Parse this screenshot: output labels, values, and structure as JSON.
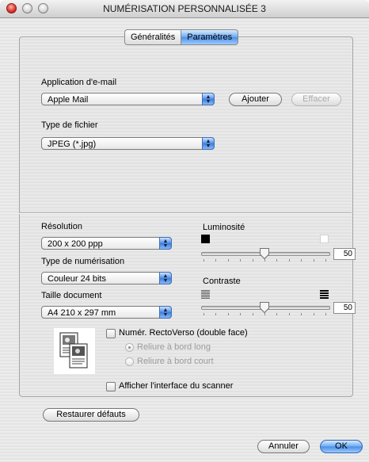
{
  "window": {
    "title": "NUMÉRISATION PERSONNALISÉE 3"
  },
  "tabs": [
    {
      "label": "Généralités",
      "active": false
    },
    {
      "label": "Paramètres",
      "active": true
    }
  ],
  "email": {
    "label": "Application d'e-mail",
    "selected": "Apple Mail",
    "add_button": "Ajouter",
    "delete_button": "Effacer"
  },
  "file_type": {
    "label": "Type de fichier",
    "selected": "JPEG (*.jpg)"
  },
  "resolution": {
    "label": "Résolution",
    "selected": "200 x 200 ppp"
  },
  "scan_type": {
    "label": "Type de numérisation",
    "selected": "Couleur 24 bits"
  },
  "doc_size": {
    "label": "Taille document",
    "selected": "A4  210 x 297 mm"
  },
  "brightness": {
    "label": "Luminosité",
    "value": "50",
    "level": 0.5
  },
  "contrast": {
    "label": "Contraste",
    "value": "50",
    "level": 0.5
  },
  "duplex": {
    "label": "Numér. RectoVerso (double face)",
    "checked": false,
    "options": [
      {
        "label": "Reliure à bord long",
        "selected": true
      },
      {
        "label": "Reliure à bord court",
        "selected": false
      }
    ]
  },
  "show_scanner_ui": {
    "label": "Afficher l'interface du scanner",
    "checked": false
  },
  "restore_button": "Restaurer défauts",
  "cancel_button": "Annuler",
  "ok_button": "OK",
  "colors": {
    "accent": "#4f90e6"
  },
  "icons": [
    "arrows-icon",
    "dark-square-icon",
    "white-square-icon",
    "low-contrast-icon",
    "high-contrast-icon",
    "slider-thumb-icon",
    "duplex-document-icon"
  ]
}
